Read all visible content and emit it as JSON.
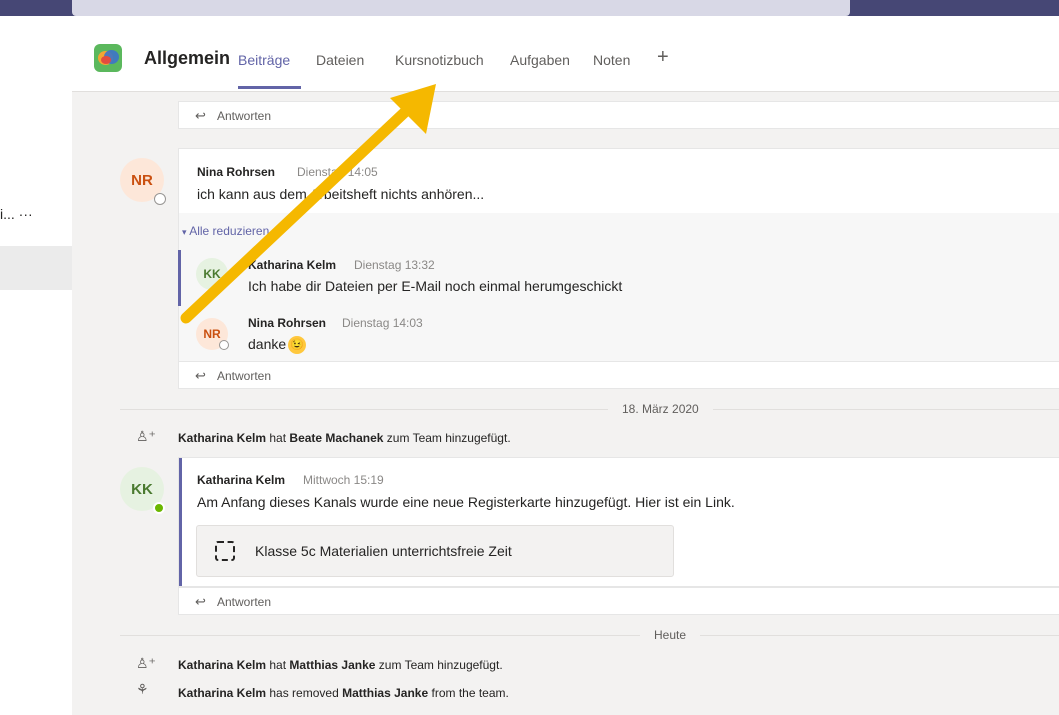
{
  "header": {
    "channel_title": "Allgemein",
    "tabs": [
      {
        "label": "Beiträge"
      },
      {
        "label": "Dateien"
      },
      {
        "label": "Kursnotizbuch"
      },
      {
        "label": "Aufgaben"
      },
      {
        "label": "Noten"
      }
    ],
    "add_tab_label": "+"
  },
  "left_pane": {
    "truncated_item": "i... ···"
  },
  "reply_label": "Antworten",
  "thread1": {
    "author": "Nina Rohrsen",
    "initials": "NR",
    "time": "Dienstag 14:05",
    "text": "ich kann aus dem Arbeitsheft nichts anhören...",
    "collapse_label": "Alle reduzieren",
    "replies": [
      {
        "author": "Katharina Kelm",
        "initials": "KK",
        "time": "Dienstag 13:32",
        "text": "Ich habe dir Dateien per E-Mail noch einmal herumgeschickt"
      },
      {
        "author": "Nina Rohrsen",
        "initials": "NR",
        "time": "Dienstag 14:03",
        "text": "danke",
        "emoji": "😉"
      }
    ]
  },
  "date_divider_1": "18. März 2020",
  "system1": {
    "actor": "Katharina Kelm",
    "verb": "hat",
    "target": "Beate Machanek",
    "rest": "zum Team hinzugefügt."
  },
  "thread2": {
    "author": "Katharina Kelm",
    "initials": "KK",
    "time": "Mittwoch 15:19",
    "text": "Am Anfang dieses Kanals wurde eine neue Registerkarte hinzugefügt. Hier ist ein Link.",
    "tab_card_title": "Klasse 5c Materialien unterrichtsfreie Zeit"
  },
  "date_divider_2": "Heute",
  "system2": {
    "actor": "Katharina Kelm",
    "verb": "hat",
    "target": "Matthias Janke",
    "rest": "zum Team hinzugefügt."
  },
  "system3": {
    "actor": "Katharina Kelm",
    "verb": "has removed",
    "target": "Matthias Janke",
    "rest": "from the team."
  },
  "icons": {
    "app": "teams-channel-icon",
    "reply": "reply-arrow-icon",
    "add_member": "add-person-icon",
    "remove_member": "remove-person-icon",
    "tab_link": "tab-placeholder-icon",
    "collapse": "caret-down-icon"
  },
  "colors": {
    "accent": "#6264a7",
    "annotation_arrow": "#f5b800",
    "header_bar": "#464775"
  }
}
